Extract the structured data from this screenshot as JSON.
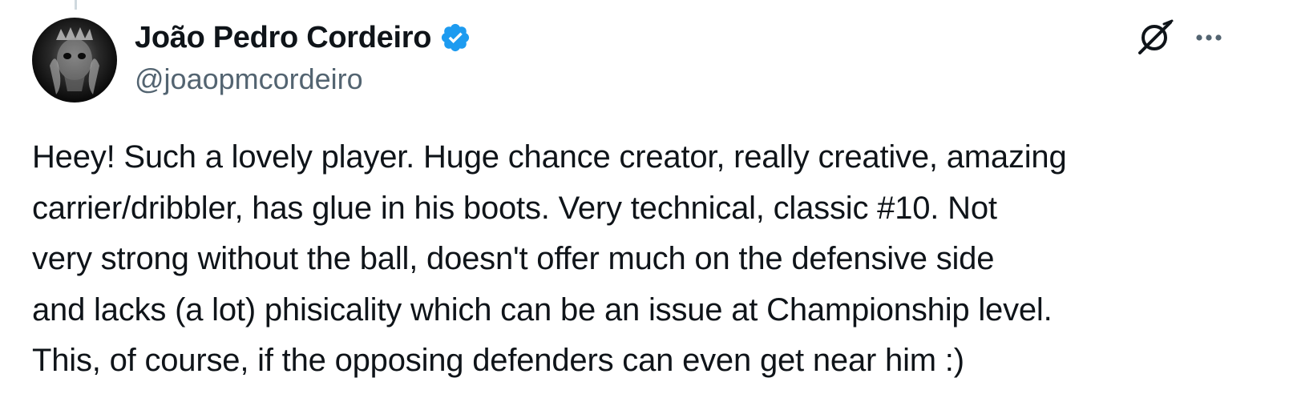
{
  "tweet": {
    "author": {
      "display_name": "João Pedro Cordeiro",
      "handle": "@joaopmcordeiro",
      "verified": true,
      "verified_color": "#1d9bf0"
    },
    "text_lines": [
      "Heey! Such a lovely player. Huge chance creator, really creative, amazing",
      "carrier/dribbler, has glue in his boots. Very technical, classic #10. Not",
      "very strong without the ball, doesn't offer much on the defensive side",
      "and lacks (a lot) phisicality which can be an issue at Championship level.",
      "This, of course, if the opposing defenders can even get near him :)"
    ],
    "icons": {
      "avatar": "avatar-image",
      "verified": "verified-badge-icon",
      "grok": "grok-icon",
      "more": "more-options-icon"
    },
    "colors": {
      "text": "#0f1419",
      "secondary": "#536471",
      "thread_line": "#cfd9de"
    }
  }
}
